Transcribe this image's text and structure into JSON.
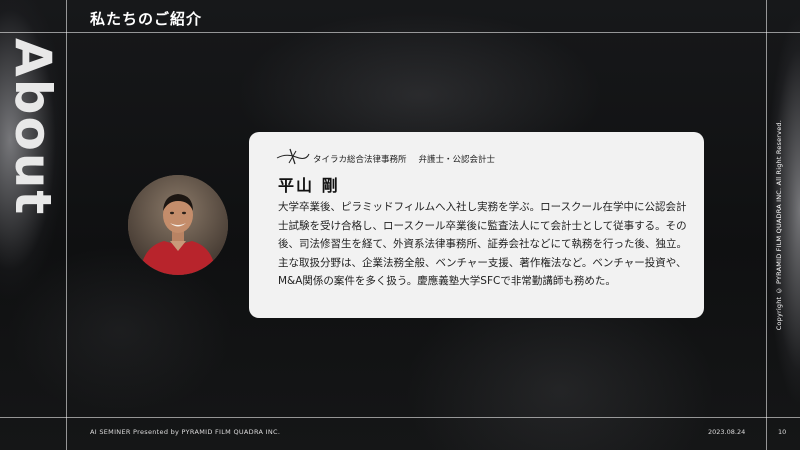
{
  "header": {
    "title": "私たちのご紹介"
  },
  "side": {
    "vertical_word": "About"
  },
  "profile": {
    "organization": "タイラカ総合法律事務所",
    "role": "弁護士・公認会計士",
    "name": "平山 剛",
    "bio": "大学卒業後、ピラミッドフィルムへ入社し実務を学ぶ。ロースクール在学中に公認会計士試験を受け合格し、ロースクール卒業後に監査法人にて会計士として従事する。その後、司法修習生を経て、外資系法律事務所、証券会社などにて執務を行った後、独立。主な取扱分野は、企業法務全般、ベンチャー支援、著作権法など。ベンチャー投資や、M&A関係の案件を多く扱う。慶應義塾大学SFCで非常勤講師も務めた。"
  },
  "footer": {
    "left": "AI SEMINER Presented by PYRAMID FILM QUADRA INC.",
    "date": "2023.08.24",
    "page": "10",
    "copyright": "Copyright © PYRAMID FILM QUADRA INC. All Right Reserved."
  },
  "colors": {
    "background": "#0e0f10",
    "card": "#f2f2f2",
    "avatar_shirt": "#b8242c"
  },
  "icons": {
    "signature": "logo-signature"
  }
}
